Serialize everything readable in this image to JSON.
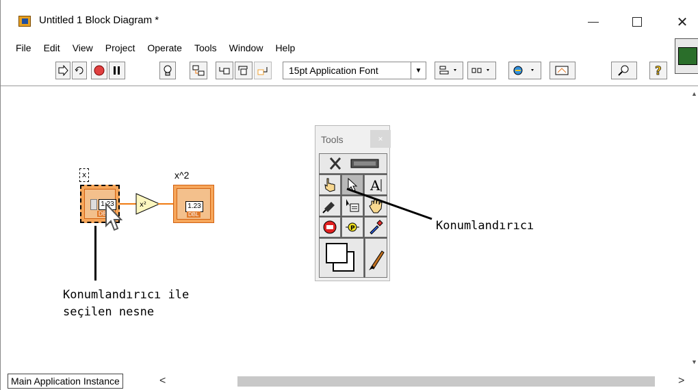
{
  "window": {
    "title": "Untitled 1 Block Diagram *"
  },
  "menu": [
    "File",
    "Edit",
    "View",
    "Project",
    "Operate",
    "Tools",
    "Window",
    "Help"
  ],
  "toolbar": {
    "font": "15pt Application Font"
  },
  "diagram": {
    "control_label": "x",
    "control_value": "1.23",
    "control_type": "DBL",
    "indicator_label": "x^2",
    "indicator_value": "1.23",
    "indicator_type": "DBL",
    "function": "x²"
  },
  "tools_palette": {
    "title": "Tools",
    "close": "×"
  },
  "annotations": {
    "positioning_tool": "Konumlandırıcı",
    "selected_object_line1": "Konumlandırıcı ile",
    "selected_object_line2": "seçilen nesne"
  },
  "status": {
    "instance": "Main Application Instance"
  },
  "colors": {
    "wire": "#f07a10",
    "terminal": "#f6a65a"
  }
}
